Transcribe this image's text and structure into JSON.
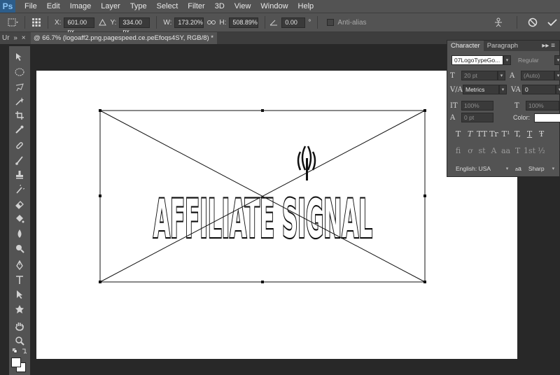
{
  "app": {
    "logo": "Ps"
  },
  "menu": [
    "File",
    "Edit",
    "Image",
    "Layer",
    "Type",
    "Select",
    "Filter",
    "3D",
    "View",
    "Window",
    "Help"
  ],
  "options": {
    "x_label": "X:",
    "x_value": "601.00 px",
    "y_label": "Y:",
    "y_value": "334.00 px",
    "w_label": "W:",
    "w_value": "173.20%",
    "h_label": "H:",
    "h_value": "508.89%",
    "angle_value": "0.00",
    "degree": "°",
    "antialias_label": "Anti-alias"
  },
  "tabs": {
    "small_tab": "Ur",
    "small_close": "×",
    "doc_tab": "@ 66.7% (logoaff2.png.pagespeed.ce.peEfoqs4SY, RGB/8) *",
    "doc_close": "×"
  },
  "canvas": {
    "artwork_text": "AFFILIATE SIGNAL"
  },
  "character_panel": {
    "tabs": [
      "Character",
      "Paragraph"
    ],
    "font_family": "07LogoTypeGo...",
    "font_style": "Regular",
    "font_size": "20 pt",
    "leading": "(Auto)",
    "kerning": "Metrics",
    "tracking": "0",
    "vertical_scale": "100%",
    "horizontal_scale": "100%",
    "baseline_shift": "0 pt",
    "color_label": "Color:",
    "language": "English: USA",
    "aa_label": "a",
    "antialias_method": "Sharp",
    "style_buttons": [
      "T",
      "T",
      "TT",
      "Tr",
      "T¹",
      "T,",
      "T",
      "Ŧ"
    ],
    "opentype_buttons": [
      "fi",
      "ơ",
      "st",
      "A",
      "aa",
      "T",
      "1st",
      "½"
    ]
  },
  "colors": {
    "chrome": "#535353",
    "workspace": "#282828",
    "canvas": "#ffffff",
    "accent": "#2d5d8a"
  }
}
